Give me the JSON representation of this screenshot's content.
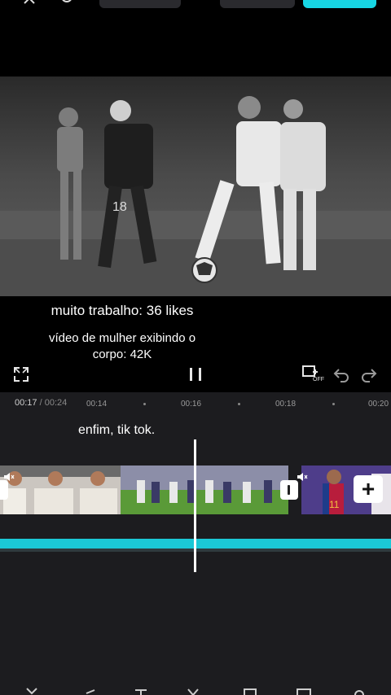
{
  "overlay": {
    "line1": "muito trabalho: 36 likes",
    "line2": "vídeo de mulher exibindo o corpo: 42K"
  },
  "timeline": {
    "current_time": "00:17",
    "separator": "/",
    "total_time": "00:24",
    "ruler_ticks": [
      "00:14",
      "00:16",
      "00:18",
      "00:20"
    ],
    "caption": "enfim, tik tok."
  },
  "icons": {
    "fullscreen": "fullscreen-icon",
    "pause": "pause-icon",
    "keyframe": "keyframe-off-icon",
    "undo": "undo-icon",
    "redo": "redo-icon",
    "mute": "mute-icon",
    "add": "plus-icon"
  },
  "keyframe_badge": "OFF",
  "add_label": "+",
  "colors": {
    "accent": "#17d6e4",
    "audio_track": "#1bc8d6",
    "timeline_bg": "#1c1c1f"
  }
}
